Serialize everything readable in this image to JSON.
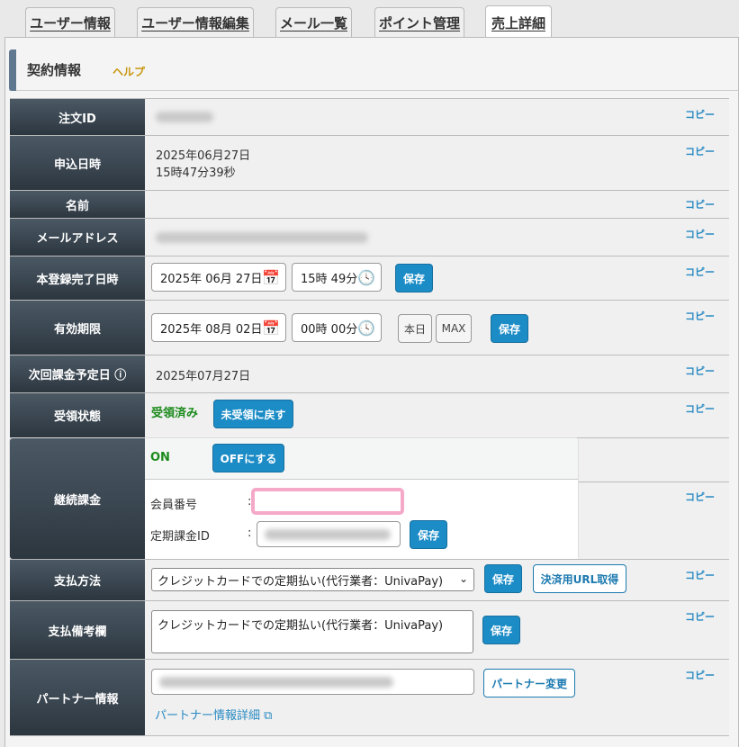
{
  "tabs": [
    {
      "label": "ユーザー情報"
    },
    {
      "label": "ユーザー情報編集"
    },
    {
      "label": "メール一覧"
    },
    {
      "label": "ポイント管理"
    },
    {
      "label": "売上詳細"
    }
  ],
  "section": {
    "title": "契約情報",
    "help": "ヘルプ"
  },
  "copy_label": "コピー",
  "rows": {
    "order_id": {
      "label": "注文ID"
    },
    "applied_at": {
      "label": "申込日時",
      "date": "2025年06月27日",
      "time": "15時47分39秒"
    },
    "name": {
      "label": "名前"
    },
    "email": {
      "label": "メールアドレス"
    },
    "registered_at": {
      "label": "本登録完了日時",
      "date": "2025年 06月 27日",
      "time": "15時 49分",
      "save": "保存"
    },
    "expiry": {
      "label": "有効期限",
      "date": "2025年 08月 02日",
      "time": "00時 00分",
      "today": "本日",
      "max": "MAX",
      "save": "保存"
    },
    "next_billing": {
      "label": "次回課金予定日",
      "info_icon": "ⓘ",
      "value": "2025年07月27日"
    },
    "receipt": {
      "label": "受領状態",
      "status": "受領済み",
      "revert": "未受領に戻す"
    },
    "recurring": {
      "label": "継続課金",
      "status": "ON",
      "off_button": "OFFにする",
      "member_no_label": "会員番号",
      "billing_id_label": "定期課金ID",
      "colon": ":",
      "save": "保存"
    },
    "payment": {
      "label": "支払方法",
      "selected": "クレジットカードでの定期払い(代行業者：UnivaPay)",
      "save": "保存",
      "url_button": "決済用URL取得"
    },
    "payment_note": {
      "label": "支払備考欄",
      "value": "クレジットカードでの定期払い(代行業者：UnivaPay)",
      "save": "保存"
    },
    "partner": {
      "label": "パートナー情報",
      "change": "パートナー変更",
      "detail_link": "パートナー情報詳細"
    }
  }
}
